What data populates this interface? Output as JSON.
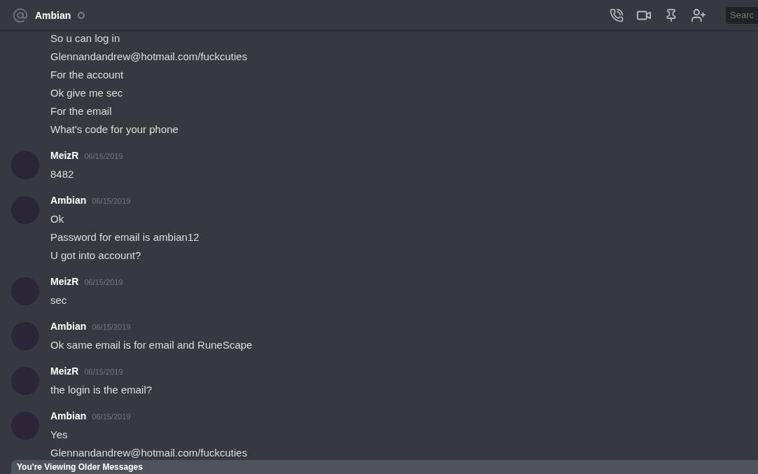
{
  "header": {
    "title": "Ambian",
    "search": {
      "placeholder": "Searc"
    }
  },
  "messages": [
    {
      "lines": [
        "So u can log in",
        "Glennandandrew@hotmail.com/fuckcuties",
        "For the account",
        "Ok give me sec",
        "For the email",
        "What's code for your phone"
      ]
    },
    {
      "author": "MeizR",
      "time": "06/15/2019",
      "lines": [
        "8482"
      ]
    },
    {
      "author": "Ambian",
      "time": "06/15/2019",
      "lines": [
        "Ok",
        "Password for email is ambian12",
        "U got into account?"
      ]
    },
    {
      "author": "MeizR",
      "time": "06/15/2019",
      "lines": [
        "sec"
      ]
    },
    {
      "author": "Ambian",
      "time": "06/15/2019",
      "lines": [
        "Ok same email is for email and RuneScape"
      ]
    },
    {
      "author": "MeizR",
      "time": "06/15/2019",
      "lines": [
        "the login is the email?"
      ]
    },
    {
      "author": "Ambian",
      "time": "06/15/2019",
      "lines": [
        "Yes",
        "Glennandandrew@hotmail.com/fuckcuties"
      ]
    }
  ],
  "notice": {
    "text": "You're Viewing Older Messages"
  }
}
